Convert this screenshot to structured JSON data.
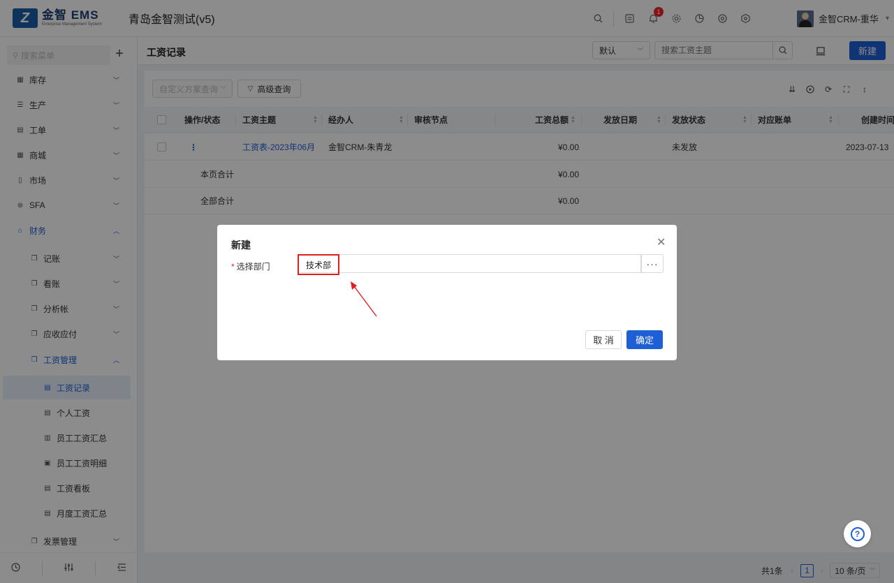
{
  "header": {
    "logo_mark": "Z",
    "logo_name": "金智 EMS",
    "logo_sub": "Enterprise Management System",
    "app_title": "青岛金智测试(v5)",
    "notification_count": "1",
    "user_name": "金智CRM-重华"
  },
  "sidebar": {
    "search_placeholder": "搜索菜单",
    "items": [
      {
        "label": "库存"
      },
      {
        "label": "生产"
      },
      {
        "label": "工单"
      },
      {
        "label": "商城"
      },
      {
        "label": "市场"
      },
      {
        "label": "SFA"
      },
      {
        "label": "财务"
      },
      {
        "label": "记账"
      },
      {
        "label": "看账"
      },
      {
        "label": "分析帐"
      },
      {
        "label": "应收应付"
      },
      {
        "label": "工资管理"
      },
      {
        "label": "工资记录"
      },
      {
        "label": "个人工资"
      },
      {
        "label": "员工工资汇总"
      },
      {
        "label": "员工工资明细"
      },
      {
        "label": "工资看板"
      },
      {
        "label": "月度工资汇总"
      },
      {
        "label": "发票管理"
      }
    ]
  },
  "toolbar": {
    "page_title": "工资记录",
    "scheme_value": "默认",
    "search_placeholder": "搜索工资主题",
    "new_label": "新建"
  },
  "filters": {
    "custom_query_placeholder": "自定义方案查询",
    "advanced_query_label": "高级查询"
  },
  "table": {
    "columns": [
      "操作/状态",
      "工资主题",
      "经办人",
      "审核节点",
      "工资总额",
      "发放日期",
      "发放状态",
      "对应账单",
      "创建时间"
    ],
    "rows": [
      {
        "action": "⋮",
        "subject": "工资表-2023年06月",
        "handler": "金智CRM-朱青龙",
        "node": "",
        "total": "¥0.00",
        "date": "",
        "status": "未发放",
        "bill": "",
        "created": "2023-07-13"
      }
    ],
    "page_total_label": "本页合计",
    "page_total_value": "¥0.00",
    "all_total_label": "全部合计",
    "all_total_value": "¥0.00"
  },
  "pagination": {
    "count_label": "共1条",
    "current_page": "1",
    "page_size": "10 条/页"
  },
  "modal": {
    "title": "新建",
    "field_label": "选择部门",
    "field_value": "技术部",
    "more_label": "···",
    "cancel_label": "取 消",
    "ok_label": "确定"
  },
  "colors": {
    "primary": "#1f5fd6",
    "highlight_border": "#e01e1e",
    "badge": "#f5222d"
  }
}
